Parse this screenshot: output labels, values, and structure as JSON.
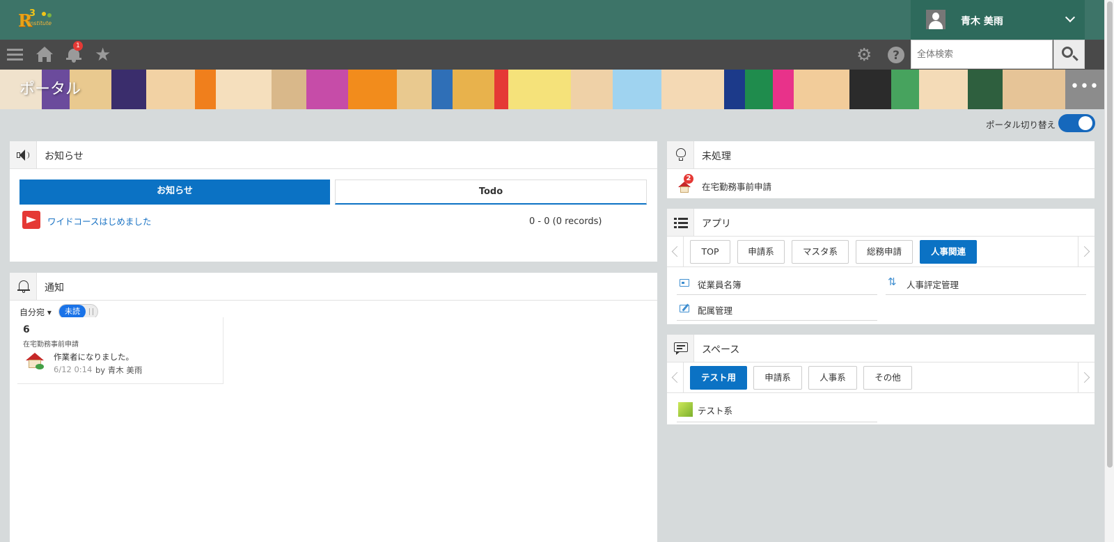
{
  "header": {
    "logo": {
      "letter": "R",
      "number": "3",
      "sub": "institute"
    },
    "user": {
      "name": "青木 美雨"
    }
  },
  "navbar": {
    "notification_count": "1",
    "search": {
      "placeholder": "全体検索"
    }
  },
  "banner": {
    "title": "ポータル",
    "more": "•••"
  },
  "portal_switch": {
    "label": "ポータル切り替え",
    "on": true
  },
  "notice_panel": {
    "title": "お知らせ",
    "tabs": [
      {
        "label": "お知らせ",
        "active": true
      },
      {
        "label": "Todo",
        "active": false
      }
    ],
    "items": [
      {
        "text": "ワイドコースはじめました"
      }
    ],
    "records": "0 - 0 (0 records)"
  },
  "notification_panel": {
    "title": "通知",
    "filter": "自分宛",
    "unread_toggle": "未読",
    "card": {
      "count": "6",
      "app": "在宅勤務事前申請",
      "message": "作業者になりました。",
      "time": "6/12 0:14",
      "by": "by 青木 美雨"
    }
  },
  "pending_panel": {
    "title": "未処理",
    "items": [
      {
        "text": "在宅勤務事前申請",
        "badge": "2"
      }
    ]
  },
  "app_panel": {
    "title": "アプリ",
    "categories": [
      {
        "label": "TOP",
        "active": false
      },
      {
        "label": "申請系",
        "active": false
      },
      {
        "label": "マスタ系",
        "active": false
      },
      {
        "label": "総務申請",
        "active": false
      },
      {
        "label": "人事関連",
        "active": true
      }
    ],
    "apps": [
      {
        "label": "従業員名簿",
        "icon": "card-icon"
      },
      {
        "label": "人事評定管理",
        "icon": "swap-icon"
      },
      {
        "label": "配属管理",
        "icon": "edit-icon"
      }
    ]
  },
  "space_panel": {
    "title": "スペース",
    "categories": [
      {
        "label": "テスト用",
        "active": true
      },
      {
        "label": "申請系",
        "active": false
      },
      {
        "label": "人事系",
        "active": false
      },
      {
        "label": "その他",
        "active": false
      }
    ],
    "spaces": [
      {
        "label": "テスト系"
      }
    ]
  },
  "colors": {
    "header": "#3d7468",
    "navbar": "#494949",
    "accent": "#0b72c4",
    "badge": "#e53935"
  }
}
